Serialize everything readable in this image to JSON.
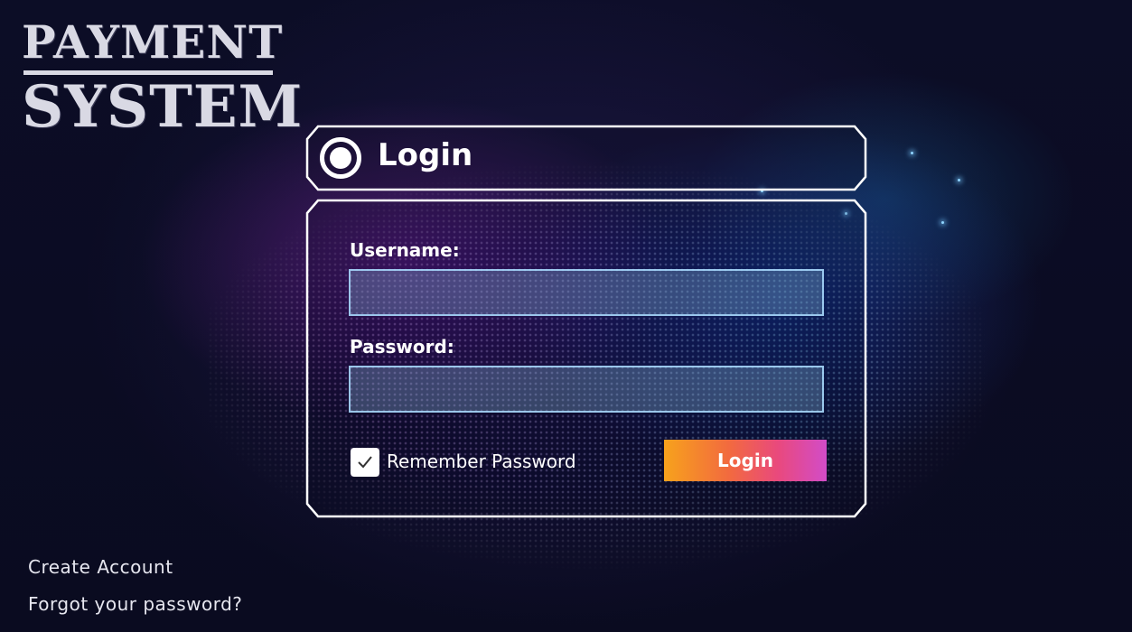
{
  "brand": {
    "line1": "PAYMENT",
    "line2": "SYSTEM"
  },
  "login_header": {
    "title": "Login",
    "icon": "radio-circle-icon"
  },
  "form": {
    "username_label": "Username:",
    "username_value": "",
    "password_label": "Password:",
    "password_value": "",
    "remember_label": "Remember Password",
    "remember_checked": true,
    "login_button": "Login"
  },
  "links": {
    "create_account": "Create Account",
    "forgot_password": "Forgot your password?"
  },
  "colors": {
    "background": "#0a0b22",
    "frame_border": "#ffffff",
    "input_border": "#aadcff",
    "button_gradient": [
      "#f7a21c",
      "#f26a3f",
      "#e9497d",
      "#d24cc8"
    ]
  }
}
